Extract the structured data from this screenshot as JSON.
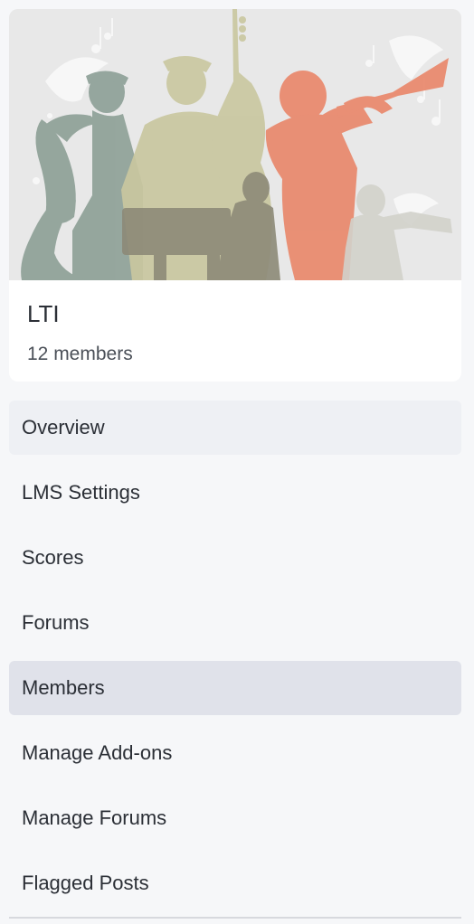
{
  "group": {
    "name": "LTI",
    "members": "12 members"
  },
  "nav": {
    "items": [
      {
        "label": "Overview"
      },
      {
        "label": "LMS Settings"
      },
      {
        "label": "Scores"
      },
      {
        "label": "Forums"
      },
      {
        "label": "Members"
      },
      {
        "label": "Manage Add-ons"
      },
      {
        "label": "Manage Forums"
      },
      {
        "label": "Flagged Posts"
      }
    ]
  },
  "colors": {
    "background": "#f6f7f9",
    "card": "#ffffff",
    "selected_item": "#e0e2ea",
    "hover_item": "#eef0f4",
    "text": "#2b2f36",
    "banner_gray": "#91a39a",
    "banner_olive": "#c9c7a0",
    "banner_coral": "#e98b6f",
    "banner_brown": "#8d8a78"
  },
  "icons": {
    "banner": "jazz-musicians-banner"
  }
}
